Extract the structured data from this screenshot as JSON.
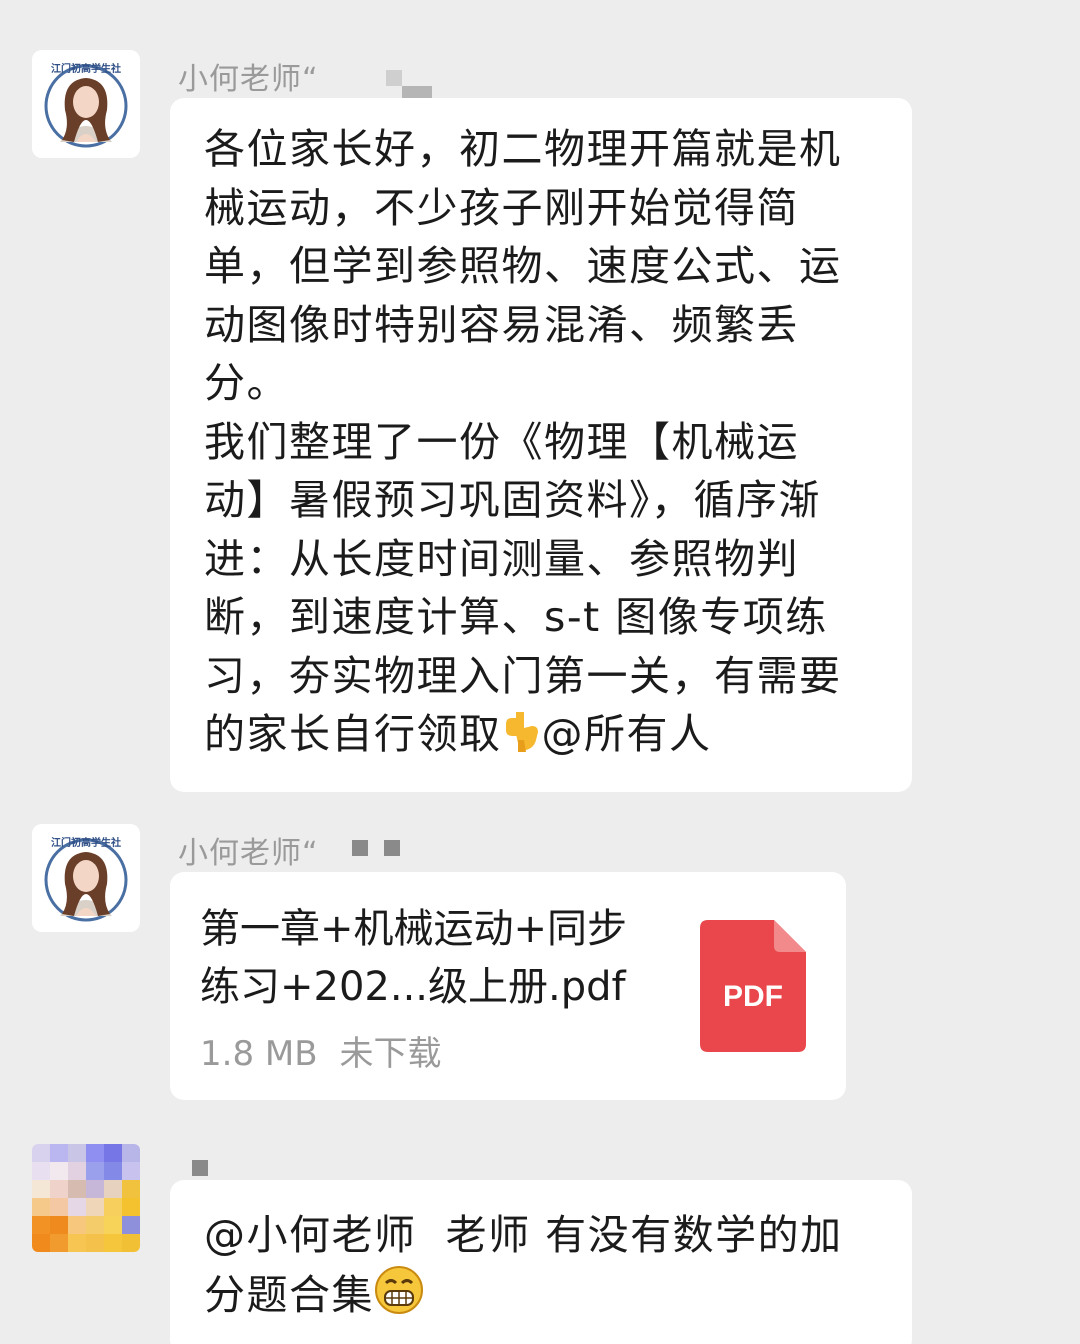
{
  "messages": [
    {
      "sender": "小何老师“",
      "avatar_icon": "teacher-avatar-icon",
      "avatar_label": "江门初高学生社",
      "lines": [
        "各位家长好，初二物理开篇就是机",
        "械运动，不少孩子刚开始觉得简",
        "单，但学到参照物、速度公式、运",
        "动图像时特别容易混淆、频繁丢",
        "分。",
        "我们整理了一份《物理【机械运",
        "动】暑假预习巩固资料》，循序渐",
        "进：从长度时间测量、参照物判",
        "断，到速度计算、s-t 图像专项练",
        "习，夯实物理入门第一关，有需要"
      ],
      "last_line_before_emoji": "的家长自行领取",
      "emoji": "pointing-down-emoji",
      "last_line_after_emoji": "@所有人"
    },
    {
      "sender": "小何老师“",
      "avatar_icon": "teacher-avatar-icon",
      "avatar_label": "江门初高学生社",
      "file": {
        "name_line1": "第一章+机械运动+同步",
        "name_line2": "练习+202...级上册.pdf",
        "size": "1.8 MB",
        "status": "未下载",
        "type_label": "PDF",
        "icon_color": "#e9474b"
      }
    },
    {
      "sender": "",
      "avatar_icon": "pixelated-avatar-icon",
      "line1": "@小何老师  老师 有没有数学的加",
      "line2": "分题合集",
      "emoji": "grinning-emoji"
    }
  ],
  "colors": {
    "background": "#ededed",
    "bubble": "#ffffff",
    "sender_text": "#9a9a9a",
    "body_text": "#1b1b1b"
  }
}
